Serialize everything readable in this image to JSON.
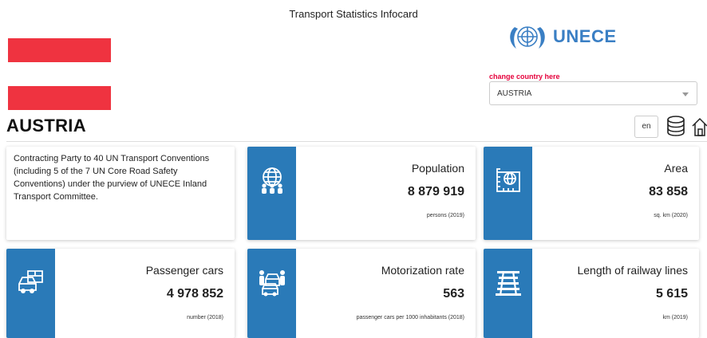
{
  "header": {
    "title": "Transport Statistics Infocard",
    "logo_text": "UNECE",
    "change_country_label": "change country here",
    "selected_country": "AUSTRIA",
    "language": "en"
  },
  "country": {
    "name": "AUSTRIA",
    "flag_colors": [
      "#ef3340",
      "#ffffff",
      "#ef3340"
    ]
  },
  "intro": {
    "text": "Contracting Party to 40 UN Transport Conventions (including 5 of the 7 UN Core Road Safety Conventions) under the purview of UNECE Inland Transport Committee."
  },
  "cards": [
    {
      "label": "Population",
      "value": "8 879 919",
      "unit": "persons (2019)",
      "icon": "globe-people-icon"
    },
    {
      "label": "Area",
      "value": "83 858",
      "unit": "sq. km (2020)",
      "icon": "map-area-icon"
    },
    {
      "label": "Passenger cars",
      "value": "4 978 852",
      "unit": "number (2018)",
      "icon": "cars-icon"
    },
    {
      "label": "Motorization rate",
      "value": "563",
      "unit": "passenger cars per 1000 inhabitants (2018)",
      "icon": "people-cars-icon"
    },
    {
      "label": "Length of railway lines",
      "value": "5 615",
      "unit": "km (2019)",
      "icon": "railway-track-icon"
    }
  ],
  "colors": {
    "accent": "#2a7ab8",
    "alert": "#e5003b",
    "logo": "#3a7fc4"
  }
}
